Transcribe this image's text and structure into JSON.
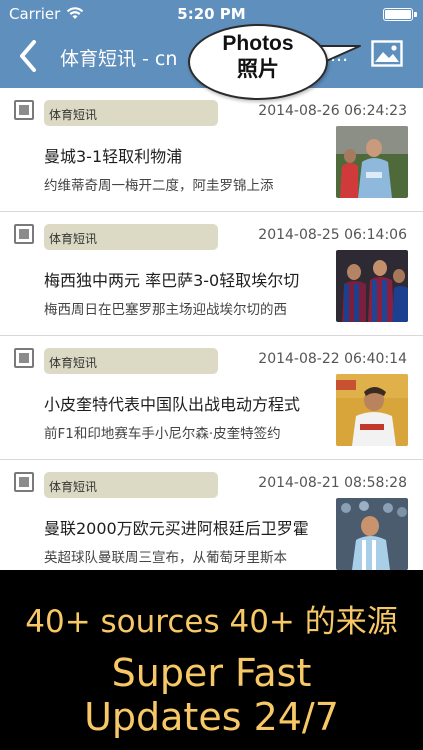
{
  "status_bar": {
    "carrier": "Carrier",
    "time": "5:20 PM"
  },
  "nav": {
    "title": "体育短讯 - cn",
    "overflow": "...",
    "back_icon": "chevron-left-icon",
    "photos_icon": "photo-icon"
  },
  "callout": {
    "line1": "Photos",
    "line2": "照片"
  },
  "articles": [
    {
      "tag": "体育短讯",
      "date": "2014-08-26 06:24:23",
      "headline": "曼城3-1轻取利物浦",
      "summary": "约维蒂奇周一梅开二度，阿圭罗锦上添"
    },
    {
      "tag": "体育短讯",
      "date": "2014-08-25 06:14:06",
      "headline": "梅西独中两元 率巴萨3-0轻取埃尔切",
      "summary": "梅西周日在巴塞罗那主场迎战埃尔切的西"
    },
    {
      "tag": "体育短讯",
      "date": "2014-08-22 06:40:14",
      "headline": "小皮奎特代表中国队出战电动方程式",
      "summary": "前F1和印地赛车手小尼尔森·皮奎特签约"
    },
    {
      "tag": "体育短讯",
      "date": "2014-08-21 08:58:28",
      "headline": "曼联2000万欧元买进阿根廷后卫罗霍",
      "summary": "英超球队曼联周三宣布，从葡萄牙里斯本"
    }
  ],
  "promo": {
    "line1": "40+ sources 40+ 的来源",
    "line2": "Super Fast",
    "line3": "Updates 24/7"
  },
  "colors": {
    "nav_blue": "#5f8fbd",
    "tag_bg": "#dcdac4",
    "promo_text": "#f7c865"
  }
}
